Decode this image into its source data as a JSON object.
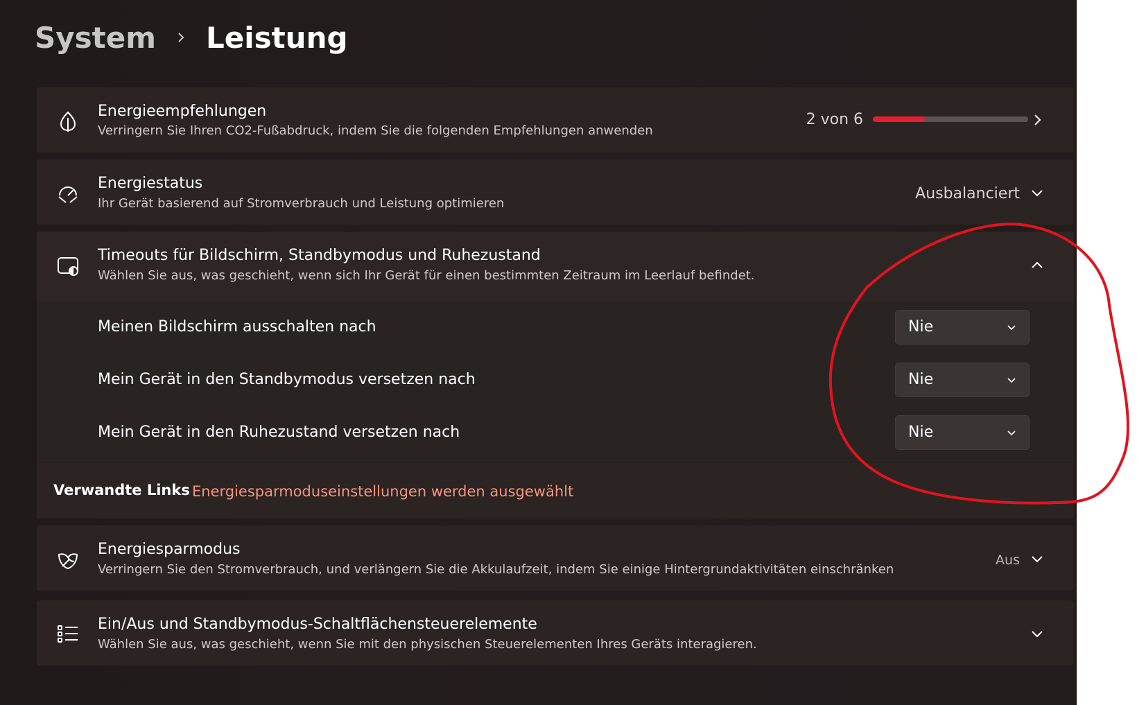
{
  "breadcrumb": {
    "parent": "System",
    "current": "Leistung"
  },
  "energy_recommendations": {
    "title": "Energieempfehlungen",
    "description": "Verringern Sie Ihren CO2-Fußabdruck, indem Sie die folgenden Empfehlungen anwenden",
    "progress_text": "2 von 6",
    "progress_fraction": 0.333,
    "icon": "leaf-icon"
  },
  "power_mode": {
    "title": "Energiestatus",
    "description": "Ihr Gerät basierend auf Stromverbrauch und Leistung optimieren",
    "value": "Ausbalanciert",
    "icon": "gauge-icon"
  },
  "timeouts": {
    "title": "Timeouts für Bildschirm, Standbymodus und Ruhezustand",
    "description": "Wählen Sie aus, was geschieht, wenn sich Ihr Gerät für einen bestimmten Zeitraum im Leerlauf befindet.",
    "icon": "screen-sleep-icon",
    "rows": [
      {
        "label": "Meinen Bildschirm ausschalten nach",
        "value": "Nie"
      },
      {
        "label": "Mein Gerät in den Standbymodus versetzen nach",
        "value": "Nie"
      },
      {
        "label": "Mein Gerät in den Ruhezustand versetzen nach",
        "value": "Nie"
      }
    ],
    "related_label": "Verwandte Links",
    "related_link": "Energiesparmoduseinstellungen werden ausgewählt"
  },
  "battery_saver": {
    "title": "Energiesparmodus",
    "description": "Verringern Sie den Stromverbrauch, und verlängern Sie die Akkulaufzeit, indem Sie einige Hintergrundaktivitäten einschränken",
    "value": "Aus",
    "icon": "battery-leaf-icon"
  },
  "power_buttons": {
    "title": "Ein/Aus und Standbymodus-Schaltflächensteuerelemente",
    "description": "Wählen Sie aus, was geschieht, wenn Sie mit den physischen Steuerelementen Ihres Geräts interagieren.",
    "icon": "list-icon"
  },
  "colors": {
    "accent": "#e51e30",
    "link": "#f5947e",
    "annotation": "#e0141e"
  }
}
